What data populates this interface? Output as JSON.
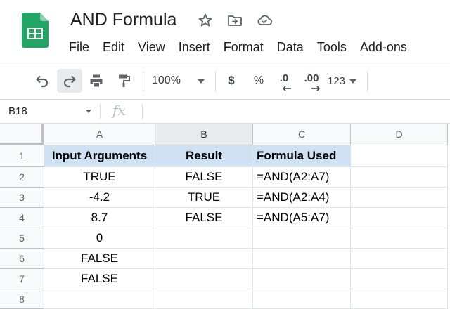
{
  "app": {
    "title": "AND Formula",
    "menu": [
      "File",
      "Edit",
      "View",
      "Insert",
      "Format",
      "Data",
      "Tools",
      "Add-ons"
    ]
  },
  "toolbar": {
    "zoom": "100%",
    "currency": "$",
    "percent": "%",
    "decrease_decimal": ".0",
    "increase_decimal": ".00",
    "more_formats": "123"
  },
  "formula_bar": {
    "cell_ref": "B18",
    "fx": "fx",
    "content": ""
  },
  "grid": {
    "columns": [
      "A",
      "B",
      "C",
      "D"
    ],
    "rows": [
      "1",
      "2",
      "3",
      "4",
      "5",
      "6",
      "7",
      "8"
    ],
    "cells": [
      [
        "Input Arguments",
        "Result",
        "Formula Used",
        ""
      ],
      [
        "TRUE",
        "FALSE",
        "=AND(A2:A7)",
        ""
      ],
      [
        "-4.2",
        "TRUE",
        "=AND(A2:A4)",
        ""
      ],
      [
        "8.7",
        "FALSE",
        "=AND(A5:A7)",
        ""
      ],
      [
        "0",
        "",
        "",
        ""
      ],
      [
        "FALSE",
        "",
        "",
        ""
      ],
      [
        "FALSE",
        "",
        "",
        ""
      ],
      [
        "",
        "",
        "",
        ""
      ]
    ]
  },
  "colors": {
    "header_fill": "#cfe2f3",
    "logo_green": "#0f9d58"
  }
}
